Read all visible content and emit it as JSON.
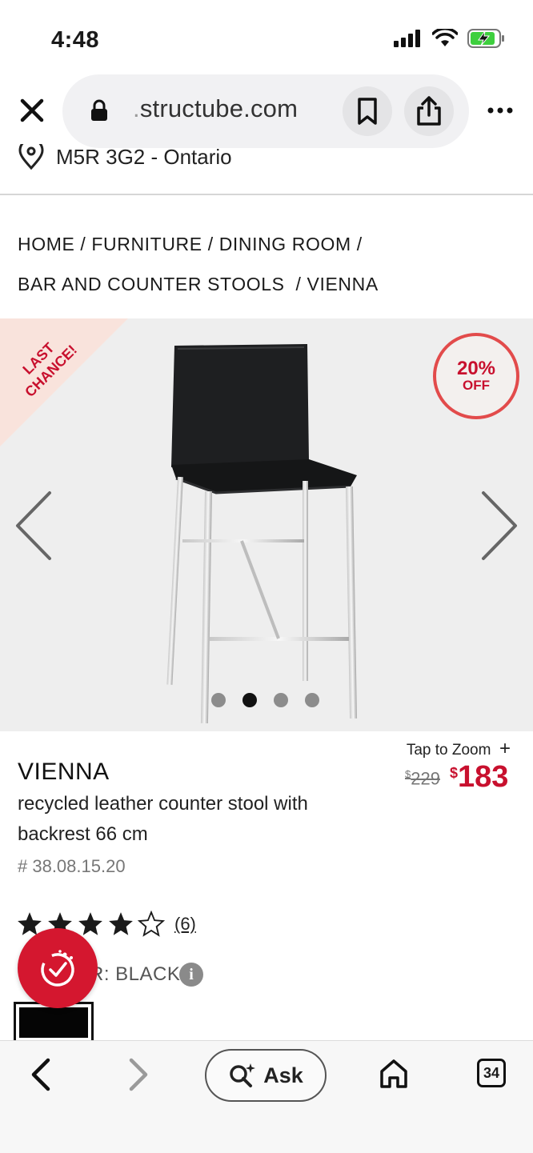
{
  "status_bar": {
    "time": "4:48"
  },
  "browser": {
    "url_domain": "structube.com",
    "url_prefix": "."
  },
  "location": {
    "text": "M5R 3G2 - Ontario"
  },
  "breadcrumb": {
    "items": [
      "HOME",
      "FURNITURE",
      "DINING ROOM",
      "BAR AND COUNTER STOOLS",
      "VIENNA"
    ],
    "separator": "/"
  },
  "gallery": {
    "ribbon_text_line1": "LAST",
    "ribbon_text_line2": "CHANCE!",
    "badge_percent": "20%",
    "badge_off": "OFF",
    "image_count": 4,
    "active_image": 2
  },
  "product": {
    "zoom_label": "Tap to Zoom",
    "zoom_icon": "+",
    "name": "VIENNA",
    "description": "recycled leather counter stool with backrest 66 cm",
    "sku": "# 38.08.15.20",
    "currency_symbol": "$",
    "old_price": "229",
    "new_price": "183",
    "rating": 4,
    "rating_max": 5,
    "review_count": "(6)",
    "color_label": "R: BLACK",
    "info_icon": "i"
  },
  "toolbar": {
    "ask_label": "Ask",
    "tab_count": "34"
  },
  "colors": {
    "brand_red": "#c8102e",
    "badge_border": "#e24b4b",
    "gallery_bg": "#eeeeee",
    "ribbon_bg": "#f9e3dc"
  }
}
